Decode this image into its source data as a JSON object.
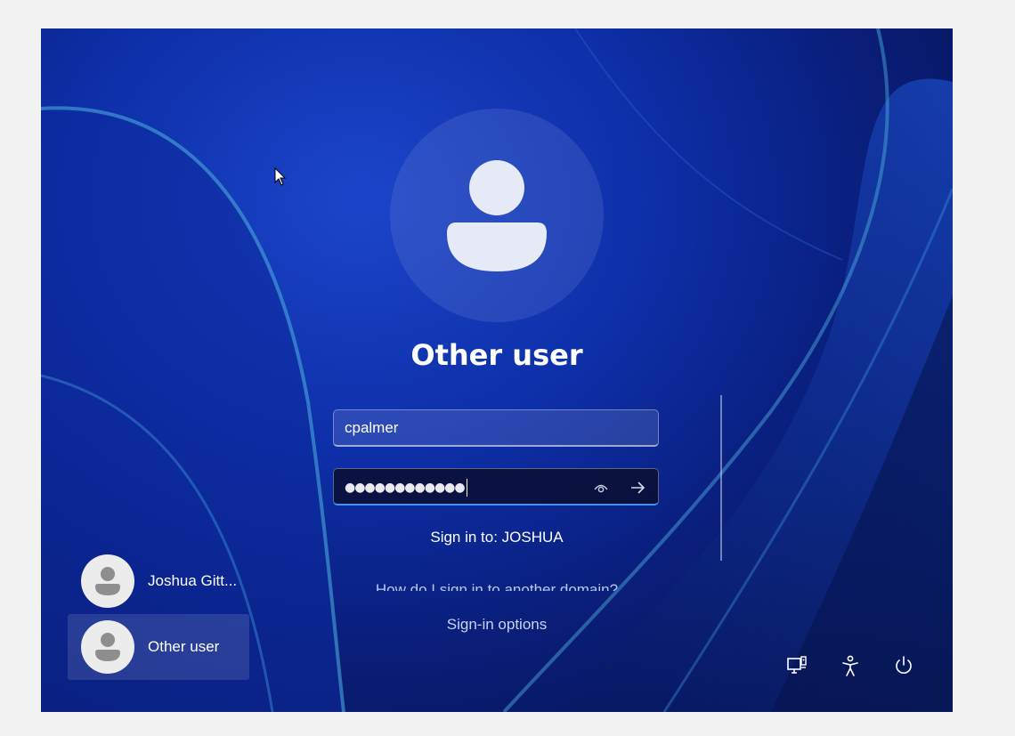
{
  "login": {
    "title": "Other user",
    "username_value": "cpalmer",
    "password_mask": "●●●●●●●●●●●●",
    "sign_in_to": "Sign in to: JOSHUA",
    "domain_help_link": "How do I sign in to another domain?",
    "sign_in_options": "Sign-in options"
  },
  "user_list": [
    {
      "name": "Joshua Gitt...",
      "selected": false
    },
    {
      "name": "Other user",
      "selected": true
    }
  ],
  "system_tray": {
    "icons": [
      "network-icon",
      "accessibility-icon",
      "power-icon"
    ]
  },
  "colors": {
    "accent": "#4a8ef0",
    "text": "#ffffff"
  }
}
